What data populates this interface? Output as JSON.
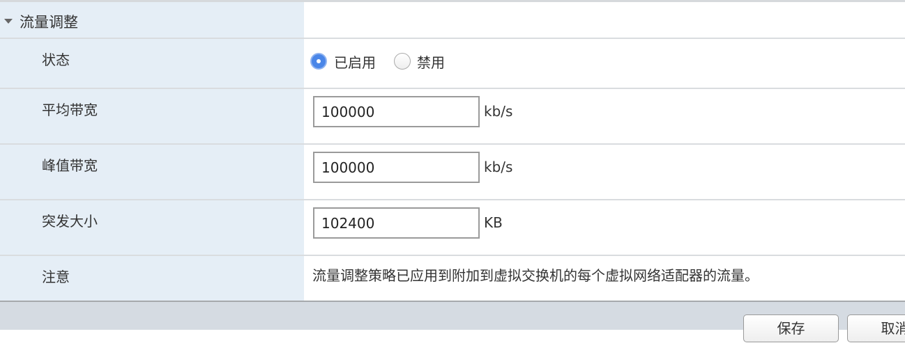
{
  "section": {
    "title": "流量调整",
    "expanded": true
  },
  "rows": [
    {
      "label": "状态",
      "radio": {
        "options": [
          "已启用",
          "禁用"
        ],
        "selected": "已启用"
      }
    },
    {
      "label": "平均带宽",
      "value": "100000",
      "unit": "kb/s"
    },
    {
      "label": "峰值带宽",
      "value": "100000",
      "unit": "kb/s"
    },
    {
      "label": "突发大小",
      "value": "102400",
      "unit": "KB"
    },
    {
      "label": "注意",
      "note": "流量调整策略已应用到附加到虚拟交换机的每个虚拟网络适配器的流量。"
    }
  ],
  "footer": {
    "save": "保存",
    "cancel": "取消"
  },
  "colors": {
    "label_bg": "#e5eef6",
    "accent": "#4a86e8",
    "footer_bg": "#d5dbe2"
  }
}
